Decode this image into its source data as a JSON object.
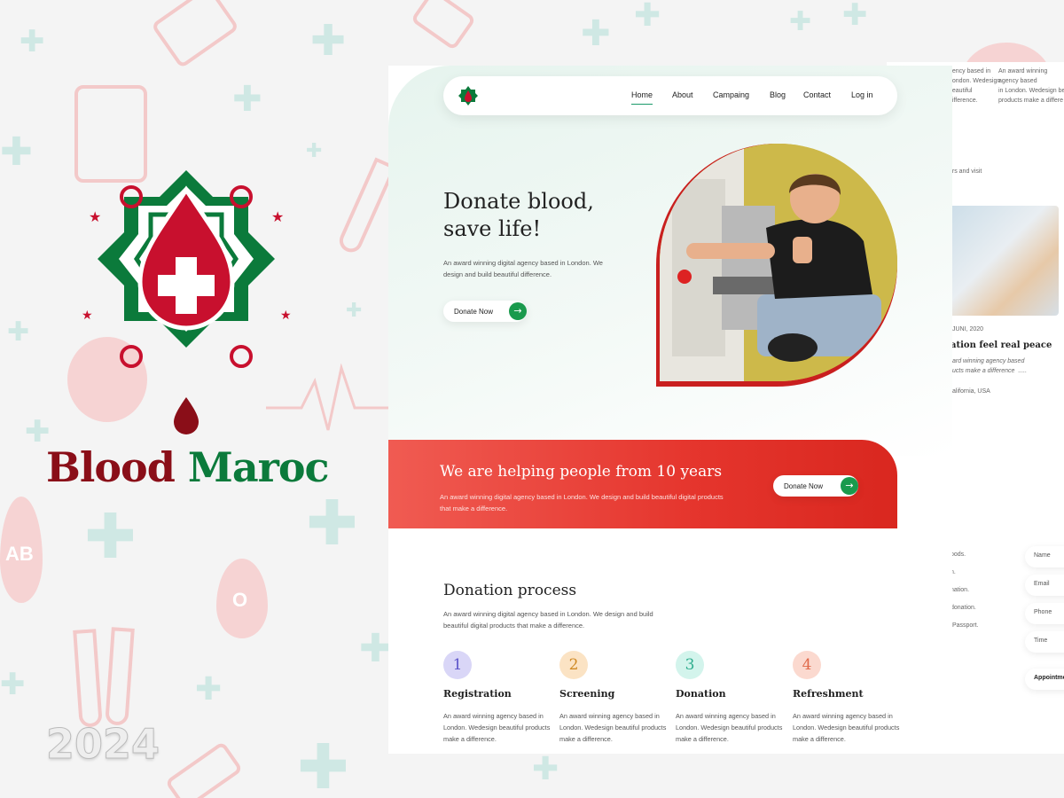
{
  "brand": {
    "word1": "Blood",
    "word2": "Maroc",
    "year": "2024"
  },
  "colors": {
    "primary_red": "#e5352d",
    "brand_green": "#0b7a3b",
    "dark_red": "#8a0e18",
    "accent_green": "#1a9a4d"
  },
  "background_icons": {
    "blood_type_a": "AB",
    "blood_type_b": "O"
  },
  "nav": {
    "items": [
      "Home",
      "About",
      "Campaing",
      "Blog",
      "Contact",
      "Log in"
    ],
    "active": "Home"
  },
  "hero": {
    "title_line1": "Donate blood,",
    "title_line2": "save life!",
    "description": "An award winning digital agency based in London. We design and build beautiful difference.",
    "cta_label": "Donate Now",
    "cta_icon": "arrow-right-icon"
  },
  "banner": {
    "title": "We are helping people from 10 years",
    "description": "An award winning digital agency based in London. We design and build beautiful digital products that  make a difference.",
    "cta_label": "Donate Now"
  },
  "process": {
    "title": "Donation process",
    "description": "An award winning digital agency based in London. We design and build beautiful digital products that  make a difference.",
    "steps": [
      {
        "num": "1",
        "title": "Registration",
        "text": "An award winning agency based in London. Wedesign beautiful products make a difference.",
        "color": "#d9d6f7",
        "ink": "#5b52c9"
      },
      {
        "num": "2",
        "title": "Screening",
        "text": "An award winning agency based in London. Wedesign beautiful products make a difference.",
        "color": "#fbe3c4",
        "ink": "#d08a24"
      },
      {
        "num": "3",
        "title": "Donation",
        "text": "An award winning agency based in London. Wedesign beautiful products make a difference.",
        "color": "#d3f4ec",
        "ink": "#2fae8e"
      },
      {
        "num": "4",
        "title": "Refreshment",
        "text": "An award winning agency based in London. Wedesign beautiful products make a difference.",
        "color": "#fbd9cf",
        "ink": "#e0694a"
      }
    ]
  },
  "secondary_page": {
    "top_col1": "gency based in\nLondon. Wedesign\nbeautiful\ndifference.",
    "top_col2": "An award winning\nagency based\nin London. Wedesign be\nproducts make a differe",
    "visit_text": "ers and visit",
    "post_date": "JUNI, 2020",
    "post_title": "ation feel real peace",
    "post_excerpt": "ard winning agency based\nucts make a difference  .....",
    "post_location": "alifornia, USA",
    "list": [
      "oods.",
      "n.",
      "nation.",
      "donation.",
      "/Passport."
    ],
    "form": {
      "name": "Name",
      "email": "Email",
      "phone": "Phone",
      "time": "Time",
      "submit": "Appointmen"
    }
  }
}
